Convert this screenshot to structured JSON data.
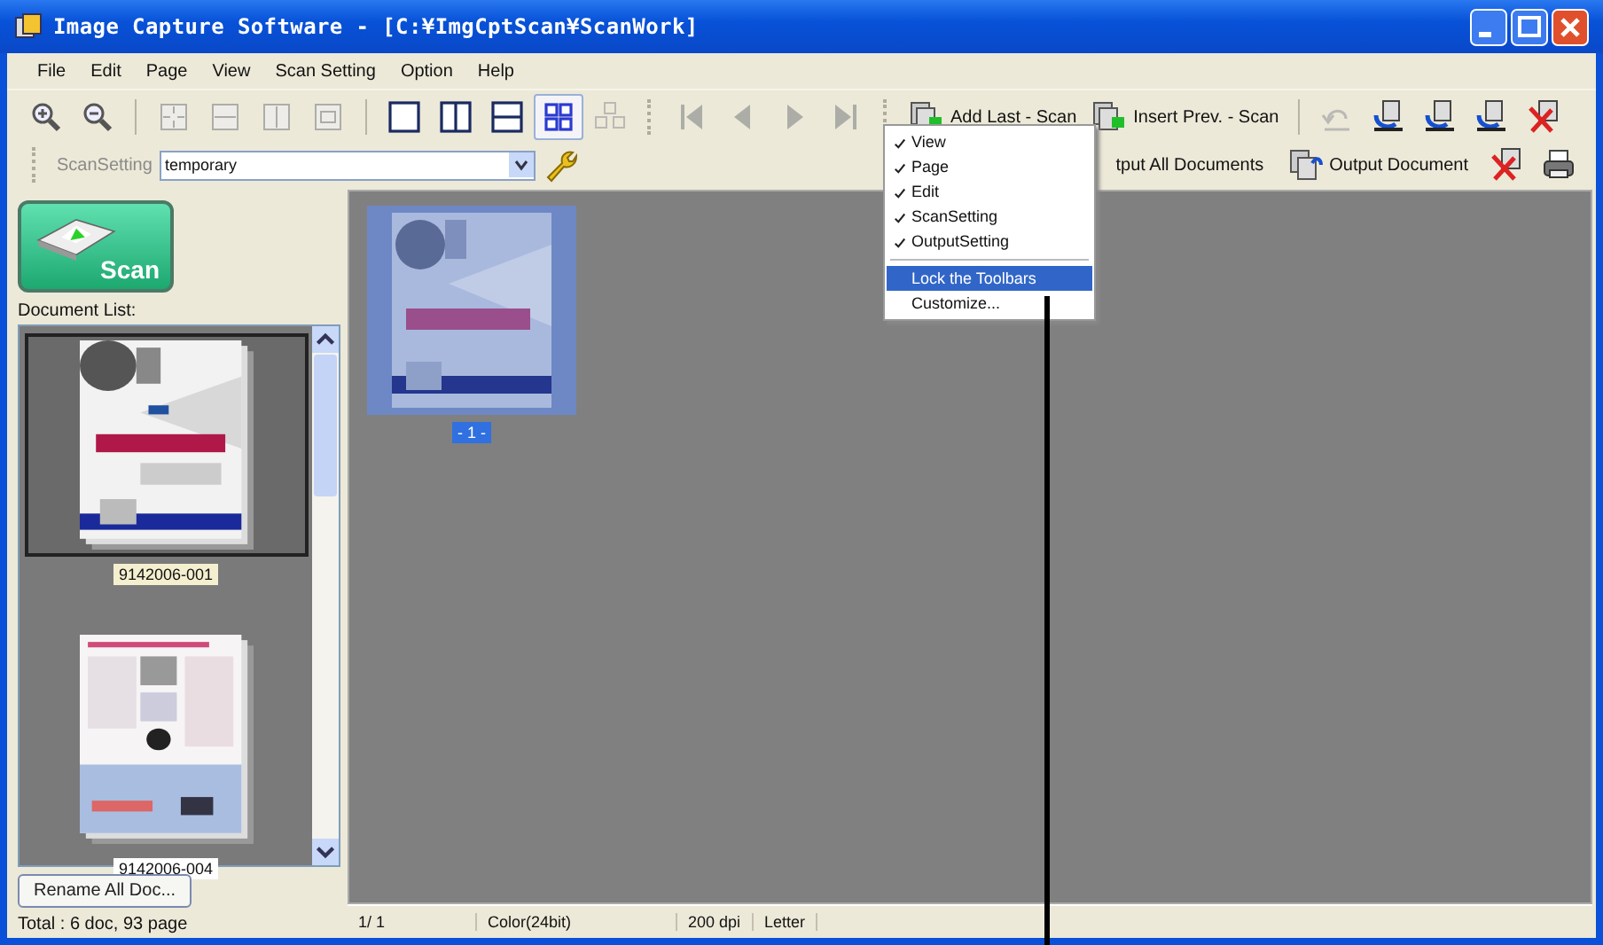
{
  "window": {
    "title": "Image Capture Software - [C:¥ImgCptScan¥ScanWork]"
  },
  "menu": [
    "File",
    "Edit",
    "Page",
    "View",
    "Scan Setting",
    "Option",
    "Help"
  ],
  "toolbar": [
    {
      "kind": "zoom-in",
      "disabled": false,
      "selected": false
    },
    {
      "kind": "zoom-out",
      "disabled": false,
      "selected": false
    },
    {
      "kind": "sep"
    },
    {
      "kind": "fit-page",
      "disabled": true,
      "selected": false
    },
    {
      "kind": "fit-width",
      "disabled": true,
      "selected": false
    },
    {
      "kind": "fit-height",
      "disabled": true,
      "selected": false
    },
    {
      "kind": "actual-size",
      "disabled": true,
      "selected": false
    },
    {
      "kind": "sep"
    },
    {
      "kind": "layout-single",
      "disabled": false,
      "selected": false
    },
    {
      "kind": "layout-columns",
      "disabled": false,
      "selected": false
    },
    {
      "kind": "layout-rows",
      "disabled": false,
      "selected": false
    },
    {
      "kind": "layout-grid",
      "disabled": false,
      "selected": true
    },
    {
      "kind": "move",
      "disabled": true,
      "selected": false
    },
    {
      "kind": "grip"
    },
    {
      "kind": "first",
      "disabled": true,
      "selected": false
    },
    {
      "kind": "prev",
      "disabled": true,
      "selected": false
    },
    {
      "kind": "next",
      "disabled": true,
      "selected": false
    },
    {
      "kind": "last",
      "disabled": true,
      "selected": false
    },
    {
      "kind": "grip"
    },
    {
      "kind": "add-scan",
      "label": "Add Last - Scan",
      "disabled": false,
      "selected": false
    },
    {
      "kind": "insert-scan",
      "label": "Insert Prev. - Scan",
      "disabled": false,
      "selected": false
    },
    {
      "kind": "sep"
    },
    {
      "kind": "undo",
      "disabled": true,
      "selected": false
    },
    {
      "kind": "rotate-left",
      "disabled": false,
      "selected": false
    },
    {
      "kind": "rotate-right",
      "disabled": false,
      "selected": false
    },
    {
      "kind": "rotate-180",
      "disabled": false,
      "selected": false
    },
    {
      "kind": "delete-page",
      "disabled": false,
      "selected": false
    }
  ],
  "scan_setting": {
    "label": "ScanSetting",
    "value": "temporary"
  },
  "output_toolbar": [
    {
      "kind": "output-all",
      "label": "tput All Documents"
    },
    {
      "kind": "output-doc",
      "label": "Output Document"
    },
    {
      "kind": "delete-doc"
    },
    {
      "kind": "print"
    }
  ],
  "toolbar_menu": {
    "items": [
      {
        "label": "View",
        "checked": true,
        "selected": false
      },
      {
        "label": "Page",
        "checked": true,
        "selected": false
      },
      {
        "label": "Edit",
        "checked": true,
        "selected": false
      },
      {
        "label": "ScanSetting",
        "checked": true,
        "selected": false
      },
      {
        "label": "OutputSetting",
        "checked": true,
        "selected": false
      },
      {
        "kind": "separator"
      },
      {
        "label": "Lock the Toolbars",
        "checked": false,
        "selected": true
      },
      {
        "label": "Customize...",
        "checked": false,
        "selected": false
      }
    ]
  },
  "scan_button": {
    "label": "Scan"
  },
  "document_list": {
    "label": "Document List:",
    "items": [
      {
        "name": "9142006-001",
        "selected": true,
        "kind": "cover"
      },
      {
        "name": "9142006-004",
        "selected": false,
        "kind": "flyer"
      }
    ]
  },
  "rename_button": "Rename All Doc...",
  "total": "Total :  6 doc,   93 page",
  "pages": [
    {
      "label": "- 1 -",
      "selected": true
    }
  ],
  "status_bar": [
    "1/  1",
    "Color(24bit)",
    "200 dpi",
    "Letter"
  ]
}
